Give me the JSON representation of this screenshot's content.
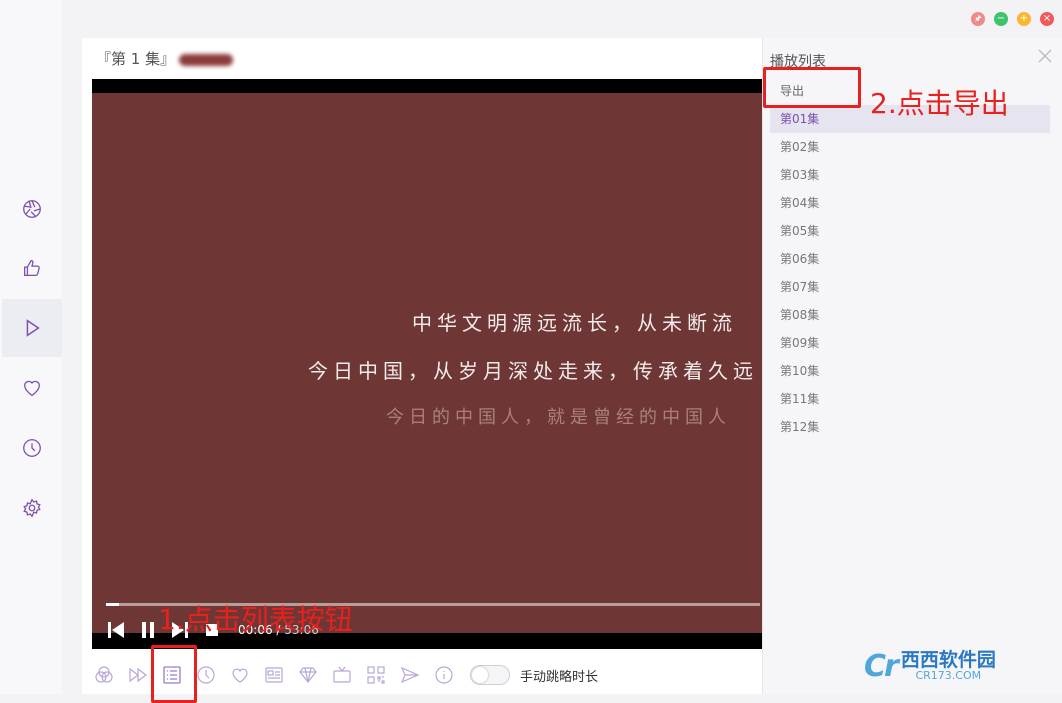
{
  "window_controls": {
    "pin": "🖈",
    "minimize": "−",
    "maximize": "+",
    "close": "×"
  },
  "colors": {
    "accent": "#7b4fae",
    "video_bg": "#6e3635",
    "annotation": "#e8201e"
  },
  "sidebar": {
    "items": [
      {
        "icon": "aperture-icon",
        "active": false
      },
      {
        "icon": "thumbs-up-icon",
        "active": false
      },
      {
        "icon": "play-icon",
        "active": true
      },
      {
        "icon": "heart-icon",
        "active": false
      },
      {
        "icon": "clock-icon",
        "active": false
      },
      {
        "icon": "gear-icon",
        "active": false
      }
    ]
  },
  "video": {
    "title": "『第 1 集』",
    "subtitle_lines": [
      "中华文明源远流长，从未断流",
      "今日中国，从岁月深处走来，传承着久远",
      "今日的中国人，就是曾经的中国人"
    ],
    "progress_fraction": 0.02,
    "time_current": "00:06",
    "time_separator": " / ",
    "time_total": "53:06"
  },
  "toolbar": {
    "icons": [
      "filter-icon",
      "skip-forward-icon",
      "list-icon",
      "clock-icon",
      "heart-icon",
      "id-card-icon",
      "diamond-icon",
      "tv-icon",
      "qr-code-icon",
      "send-icon",
      "info-icon"
    ],
    "toggle_label": "手动跳略时长"
  },
  "playlist": {
    "title": "播放列表",
    "export_label": "导出",
    "items": [
      "第01集",
      "第02集",
      "第03集",
      "第04集",
      "第05集",
      "第06集",
      "第07集",
      "第08集",
      "第09集",
      "第10集",
      "第11集",
      "第12集"
    ],
    "active_index": 0
  },
  "annotations": {
    "step1": "1.点击列表按钮",
    "step2": "2.点击导出"
  },
  "watermark": {
    "logo": "Cr",
    "main": "西西软件园",
    "sub": "CR173.COM"
  }
}
